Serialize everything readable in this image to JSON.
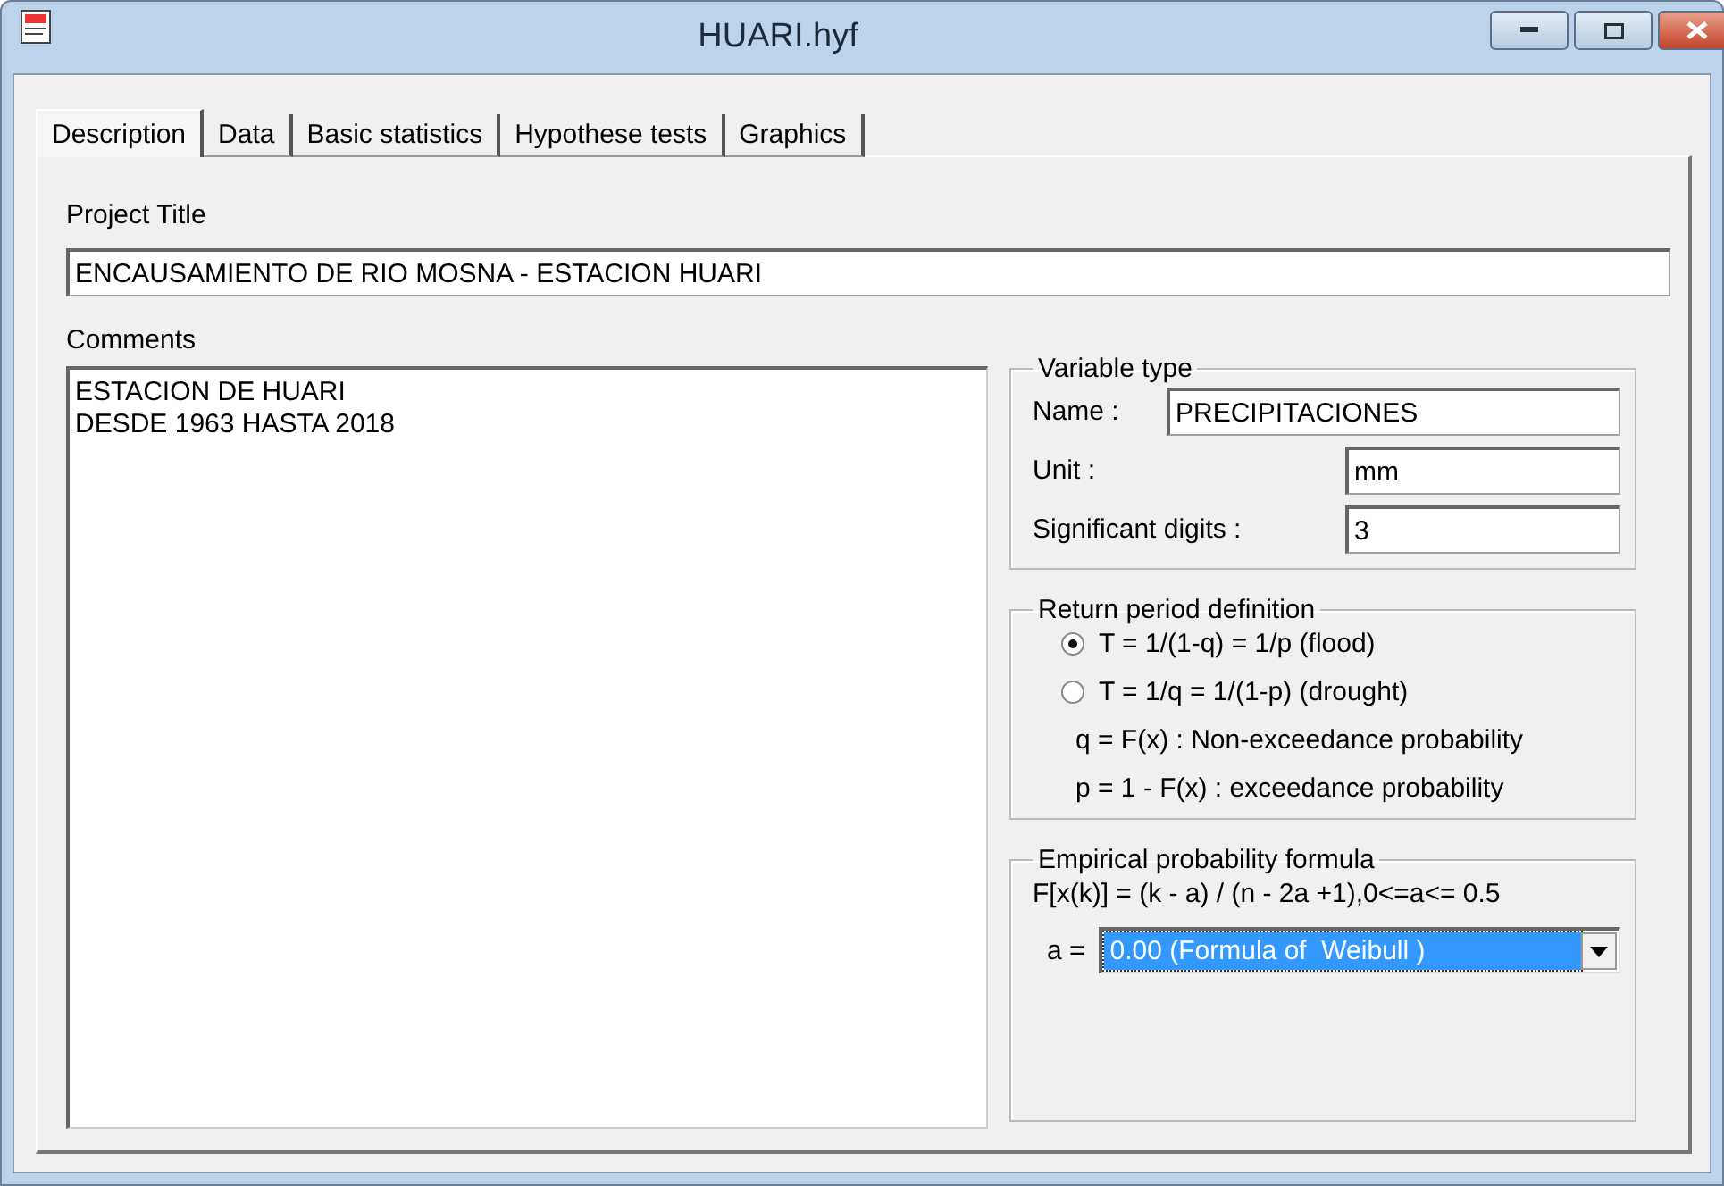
{
  "window": {
    "title": "HUARI.hyf"
  },
  "tabs": [
    {
      "label": "Description",
      "selected": true
    },
    {
      "label": "Data",
      "selected": false
    },
    {
      "label": "Basic statistics",
      "selected": false
    },
    {
      "label": "Hypothese tests",
      "selected": false
    },
    {
      "label": "Graphics",
      "selected": false
    }
  ],
  "project_title": {
    "label": "Project Title",
    "value": "ENCAUSAMIENTO DE RIO MOSNA - ESTACION HUARI"
  },
  "comments": {
    "label": "Comments",
    "value": "ESTACION DE HUARI\nDESDE 1963 HASTA 2018"
  },
  "variable_type": {
    "title": "Variable type",
    "fields": [
      {
        "label": "Name :",
        "value": "PRECIPITACIONES",
        "wide": true
      },
      {
        "label": "Unit :",
        "value": "mm",
        "wide": false
      },
      {
        "label": "Significant digits :",
        "value": "3",
        "wide": false
      }
    ]
  },
  "return_period": {
    "title": "Return period definition",
    "options": [
      {
        "label": "T = 1/(1-q)  = 1/p (flood)",
        "selected": true
      },
      {
        "label": "T = 1/q = 1/(1-p) (drought)",
        "selected": false
      }
    ],
    "notes": [
      "q = F(x) : Non-exceedance probability",
      "p = 1 - F(x) : exceedance probability"
    ]
  },
  "empirical": {
    "title": "Empirical probability formula",
    "formula": "F[x(k)] = (k - a) / (n - 2a +1),0<=a<= 0.5",
    "select_label": "a =",
    "select_value": "0.00 (Formula of  Weibull )"
  }
}
